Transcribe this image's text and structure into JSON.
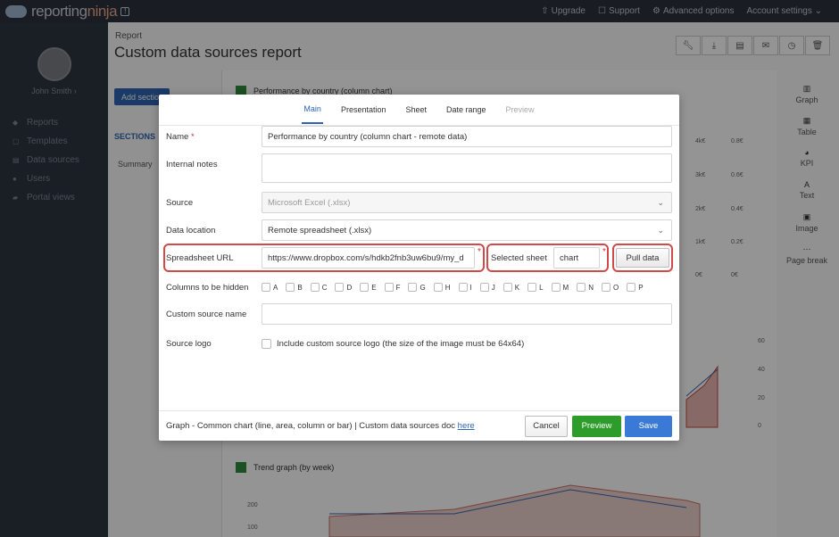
{
  "app": {
    "logo_text": "reporting",
    "logo_accent": "ninja",
    "top_nav": [
      "Upgrade",
      "Support",
      "Advanced options",
      "Account settings"
    ]
  },
  "sidebar": {
    "user_name": "John Smith",
    "items": [
      {
        "label": "Reports",
        "icon": "reports-icon"
      },
      {
        "label": "Templates",
        "icon": "templates-icon"
      },
      {
        "label": "Data sources",
        "icon": "database-icon"
      },
      {
        "label": "Users",
        "icon": "users-icon"
      },
      {
        "label": "Portal views",
        "icon": "folder-icon"
      }
    ]
  },
  "page": {
    "breadcrumb": "Report",
    "title": "Custom data sources report",
    "add_section": "Add section",
    "sections_label": "SECTIONS",
    "summary_label": "Summary",
    "bg_chart_title": "Performance by country (column chart)",
    "bg_trend_title": "Trend graph (by week)"
  },
  "right_panel": [
    {
      "label": "Graph",
      "icon": "graph-icon"
    },
    {
      "label": "Table",
      "icon": "table-icon"
    },
    {
      "label": "KPI",
      "icon": "kpi-icon"
    },
    {
      "label": "Text",
      "icon": "text-icon"
    },
    {
      "label": "Image",
      "icon": "image-icon"
    },
    {
      "label": "Page break",
      "icon": "page-break-icon"
    }
  ],
  "modal": {
    "tabs": [
      "Main",
      "Presentation",
      "Sheet",
      "Date range",
      "Preview"
    ],
    "name_label": "Name",
    "name_value": "Performance by country (column chart - remote data)",
    "notes_label": "Internal notes",
    "notes_value": "",
    "source_label": "Source",
    "source_value": "Microsoft Excel (.xlsx)",
    "location_label": "Data location",
    "location_value": "Remote spreadsheet (.xlsx)",
    "url_label": "Spreadsheet URL",
    "url_value": "https://www.dropbox.com/s/hdkb2fnb3uw6bu9/my_d",
    "sheet_label": "Selected sheet",
    "sheet_value": "chart",
    "pull_label": "Pull data",
    "columns_label": "Columns to be hidden",
    "columns": [
      "A",
      "B",
      "C",
      "D",
      "E",
      "F",
      "G",
      "H",
      "I",
      "J",
      "K",
      "L",
      "M",
      "N",
      "O",
      "P"
    ],
    "custom_name_label": "Custom source name",
    "custom_name_value": "",
    "source_logo_label": "Source logo",
    "source_logo_text": "Include custom source logo (the size of the image must be 64x64)",
    "footer_text": "Graph - Common chart (line, area, column or bar) | Custom data sources doc",
    "footer_link": "here",
    "cancel_label": "Cancel",
    "preview_label": "Preview",
    "save_label": "Save",
    "required_mark": "*"
  },
  "colors": {
    "accent": "#2f64b3",
    "preview": "#2e9c2b",
    "save": "#3a7ad6",
    "highlight": "#d14a4a"
  }
}
